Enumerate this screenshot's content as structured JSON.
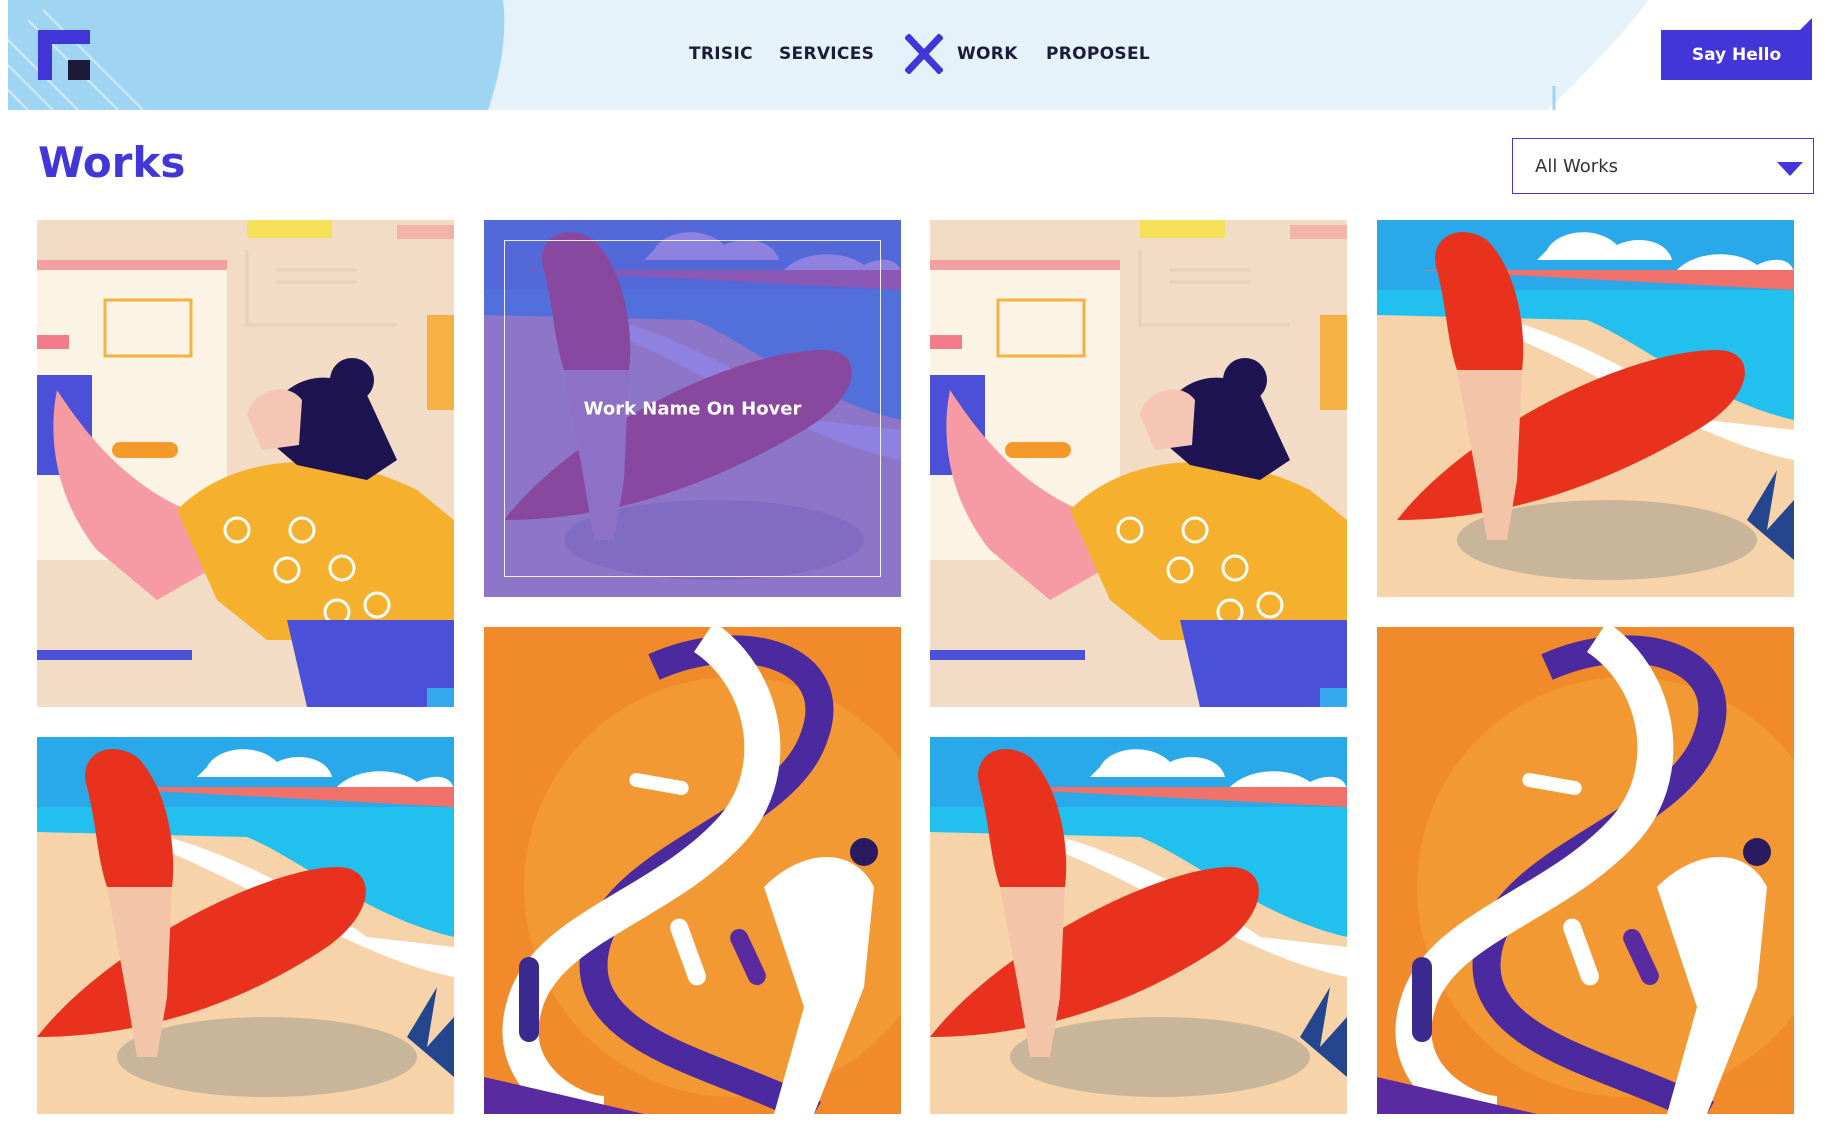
{
  "header": {
    "nav": [
      {
        "key": "trisic",
        "label": "TRISIC"
      },
      {
        "key": "services",
        "label": "SERVICES"
      },
      {
        "key": "work",
        "label": "WORK"
      },
      {
        "key": "proposel",
        "label": "PROPOSEL"
      }
    ],
    "cta_label": "Say Hello",
    "logo_icon": "logo-icon",
    "center_icon": "close-x-icon"
  },
  "page": {
    "title": "Works",
    "filter": {
      "selected": "All Works",
      "icon": "caret-down-icon"
    }
  },
  "works": [
    {
      "image": "woman-ui-illustration"
    },
    {
      "image": "surfer-illustration",
      "hover_label": "Work Name On Hover"
    },
    {
      "image": "woman-ui-illustration"
    },
    {
      "image": "surfer-illustration"
    },
    {
      "image": "surfer-illustration"
    },
    {
      "image": "dna-illustration"
    },
    {
      "image": "surfer-illustration"
    },
    {
      "image": "dna-illustration"
    }
  ],
  "colors": {
    "accent": "#4236d8",
    "header_bg": "#e6f2fa",
    "header_blob": "#9fd4f2",
    "title": "#4236d8"
  }
}
